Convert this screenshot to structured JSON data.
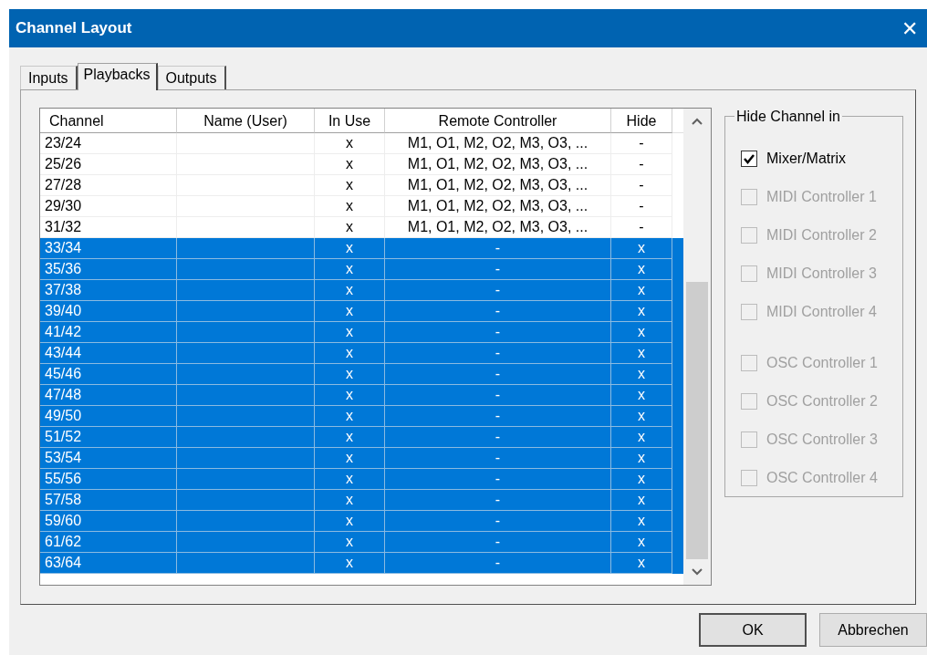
{
  "window": {
    "title": "Channel Layout",
    "close": "✕"
  },
  "tabs": [
    {
      "label": "Inputs",
      "selected": false
    },
    {
      "label": "Playbacks",
      "selected": true
    },
    {
      "label": "Outputs",
      "selected": false
    }
  ],
  "table": {
    "columns": [
      "Channel",
      "Name (User)",
      "In Use",
      "Remote Controller",
      "Hide"
    ],
    "rows": [
      {
        "channel": "23/24",
        "in_use": "x",
        "remote": "M1, O1, M2, O2, M3, O3, ...",
        "hide": "-",
        "selected": false
      },
      {
        "channel": "25/26",
        "in_use": "x",
        "remote": "M1, O1, M2, O2, M3, O3, ...",
        "hide": "-",
        "selected": false
      },
      {
        "channel": "27/28",
        "in_use": "x",
        "remote": "M1, O1, M2, O2, M3, O3, ...",
        "hide": "-",
        "selected": false
      },
      {
        "channel": "29/30",
        "in_use": "x",
        "remote": "M1, O1, M2, O2, M3, O3, ...",
        "hide": "-",
        "selected": false
      },
      {
        "channel": "31/32",
        "in_use": "x",
        "remote": "M1, O1, M2, O2, M3, O3, ...",
        "hide": "-",
        "selected": false
      },
      {
        "channel": "33/34",
        "in_use": "x",
        "remote": "-",
        "hide": "x",
        "selected": true
      },
      {
        "channel": "35/36",
        "in_use": "x",
        "remote": "-",
        "hide": "x",
        "selected": true
      },
      {
        "channel": "37/38",
        "in_use": "x",
        "remote": "-",
        "hide": "x",
        "selected": true
      },
      {
        "channel": "39/40",
        "in_use": "x",
        "remote": "-",
        "hide": "x",
        "selected": true
      },
      {
        "channel": "41/42",
        "in_use": "x",
        "remote": "-",
        "hide": "x",
        "selected": true
      },
      {
        "channel": "43/44",
        "in_use": "x",
        "remote": "-",
        "hide": "x",
        "selected": true
      },
      {
        "channel": "45/46",
        "in_use": "x",
        "remote": "-",
        "hide": "x",
        "selected": true
      },
      {
        "channel": "47/48",
        "in_use": "x",
        "remote": "-",
        "hide": "x",
        "selected": true
      },
      {
        "channel": "49/50",
        "in_use": "x",
        "remote": "-",
        "hide": "x",
        "selected": true
      },
      {
        "channel": "51/52",
        "in_use": "x",
        "remote": "-",
        "hide": "x",
        "selected": true
      },
      {
        "channel": "53/54",
        "in_use": "x",
        "remote": "-",
        "hide": "x",
        "selected": true
      },
      {
        "channel": "55/56",
        "in_use": "x",
        "remote": "-",
        "hide": "x",
        "selected": true
      },
      {
        "channel": "57/58",
        "in_use": "x",
        "remote": "-",
        "hide": "x",
        "selected": true
      },
      {
        "channel": "59/60",
        "in_use": "x",
        "remote": "-",
        "hide": "x",
        "selected": true
      },
      {
        "channel": "61/62",
        "in_use": "x",
        "remote": "-",
        "hide": "x",
        "selected": true
      },
      {
        "channel": "63/64",
        "in_use": "x",
        "remote": "-",
        "hide": "x",
        "selected": true
      }
    ]
  },
  "hide_group": {
    "title": "Hide Channel in",
    "options": [
      {
        "label": "Mixer/Matrix",
        "checked": true,
        "disabled": false
      },
      {
        "label": "MIDI Controller 1",
        "checked": false,
        "disabled": true
      },
      {
        "label": "MIDI Controller 2",
        "checked": false,
        "disabled": true
      },
      {
        "label": "MIDI Controller 3",
        "checked": false,
        "disabled": true
      },
      {
        "label": "MIDI Controller 4",
        "checked": false,
        "disabled": true
      },
      {
        "label": "OSC Controller 1",
        "checked": false,
        "disabled": true
      },
      {
        "label": "OSC Controller 2",
        "checked": false,
        "disabled": true
      },
      {
        "label": "OSC Controller 3",
        "checked": false,
        "disabled": true
      },
      {
        "label": "OSC Controller 4",
        "checked": false,
        "disabled": true
      }
    ]
  },
  "buttons": [
    "OK",
    "Abbrechen"
  ]
}
